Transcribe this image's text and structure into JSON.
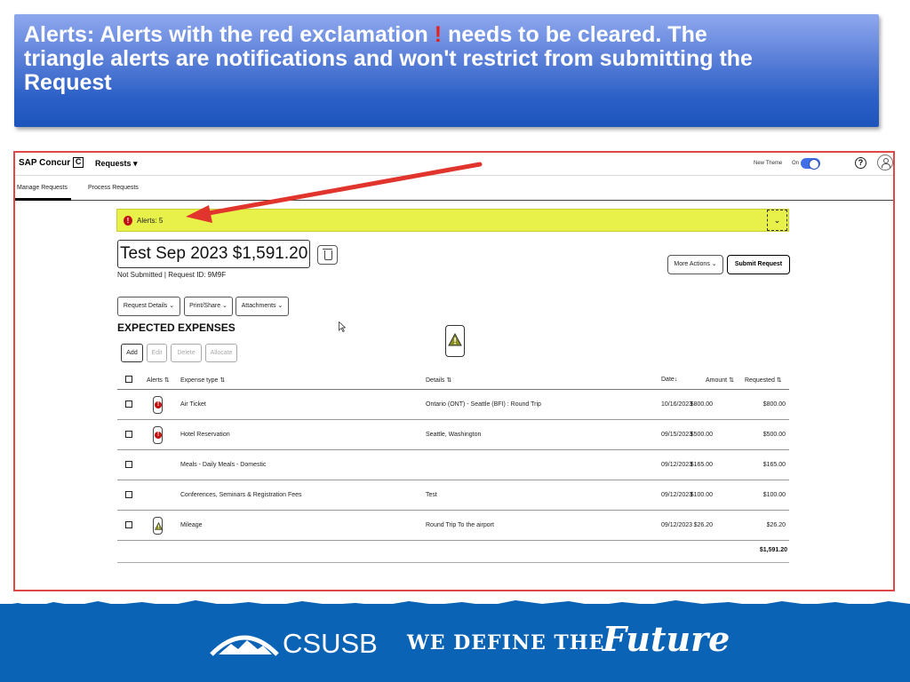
{
  "banner": {
    "line1_pre": "Alerts: Alerts with the red exclamation ",
    "excl": "!",
    "line1_post": " needs to be cleared. The",
    "line2": "triangle alerts are notifications and won't restrict from submitting the",
    "line3": "Request"
  },
  "app": {
    "logo": "SAP Concur",
    "logo_mark": "C",
    "nav_requests": "Requests ▾",
    "new_theme_label": "New Theme",
    "new_theme_state": "On",
    "help": "?",
    "tabs": [
      "Manage Requests",
      "Process Requests"
    ]
  },
  "alerts": {
    "label": "Alerts: 5",
    "chevron": "⌄"
  },
  "request": {
    "title": "Test Sep 2023 $1,591.20",
    "status_line": "Not Submitted  |  Request ID: 9M9F",
    "more_actions": "More Actions ⌄",
    "submit": "Submit Request",
    "dropdowns": [
      "Request Details ⌄",
      "Print/Share ⌄",
      "Attachments ⌄"
    ]
  },
  "expenses": {
    "section_title": "EXPECTED EXPENSES",
    "actions": [
      "Add",
      "Edit",
      "Delete",
      "Allocate"
    ],
    "headers": {
      "alerts": "Alerts ⇅",
      "type": "Expense type ⇅",
      "details": "Details ⇅",
      "date": "Date↓",
      "amount": "Amount ⇅",
      "requested": "Requested ⇅"
    },
    "rows": [
      {
        "alert": "error",
        "type": "Air Ticket",
        "details": "Ontario (ONT) - Seattle (BFI) : Round Trip",
        "date": "10/16/2023",
        "amount": "$800.00",
        "requested": "$800.00"
      },
      {
        "alert": "error",
        "type": "Hotel Reservation",
        "details": "Seattle, Washington",
        "date": "09/15/2023",
        "amount": "$500.00",
        "requested": "$500.00"
      },
      {
        "alert": "none",
        "type": "Meals - Daily Meals - Domestic",
        "details": "",
        "date": "09/12/2023",
        "amount": "$165.00",
        "requested": "$165.00"
      },
      {
        "alert": "none",
        "type": "Conferences, Seminars & Registration Fees",
        "details": "Test",
        "date": "09/12/2023",
        "amount": "$100.00",
        "requested": "$100.00"
      },
      {
        "alert": "warning",
        "type": "Mileage",
        "details": "Round Trip To the airport",
        "date": "09/12/2023",
        "amount": "$26.20",
        "requested": "$26.20"
      }
    ],
    "total": "$1,591.20"
  },
  "footer": {
    "brand": "CSUSB",
    "tagline": "WE DEFINE THE",
    "tagline_script": "Future"
  },
  "colors": {
    "banner_blue": "#2a5fc6",
    "alert_yellow": "#e8f14a",
    "error_red": "#c01010",
    "arrow_red": "#e0342c",
    "footer_blue": "#0b63b6"
  }
}
